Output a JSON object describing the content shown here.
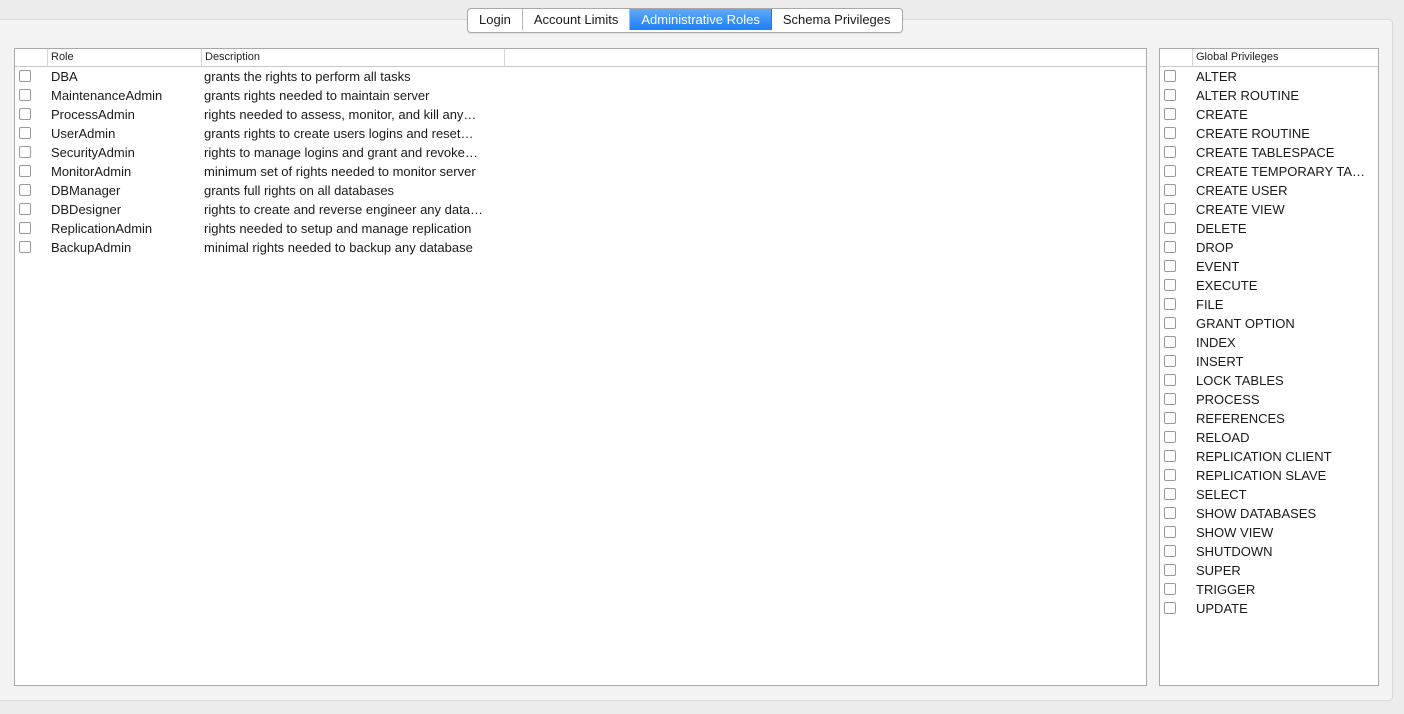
{
  "tabs": [
    {
      "label": "Login",
      "active": false
    },
    {
      "label": "Account Limits",
      "active": false
    },
    {
      "label": "Administrative Roles",
      "active": true
    },
    {
      "label": "Schema Privileges",
      "active": false
    }
  ],
  "roles_table": {
    "columns": {
      "role": "Role",
      "description": "Description"
    },
    "rows": [
      {
        "role": "DBA",
        "description": "grants the rights to perform all tasks",
        "checked": false
      },
      {
        "role": "MaintenanceAdmin",
        "description": "grants rights needed to maintain server",
        "checked": false
      },
      {
        "role": "ProcessAdmin",
        "description": "rights needed to assess, monitor, and kill any…",
        "checked": false
      },
      {
        "role": "UserAdmin",
        "description": "grants rights to create users logins and reset…",
        "checked": false
      },
      {
        "role": "SecurityAdmin",
        "description": "rights to manage logins and grant and revoke…",
        "checked": false
      },
      {
        "role": "MonitorAdmin",
        "description": "minimum set of rights needed to monitor server",
        "checked": false
      },
      {
        "role": "DBManager",
        "description": "grants full rights on all databases",
        "checked": false
      },
      {
        "role": "DBDesigner",
        "description": "rights to create and reverse engineer any data…",
        "checked": false
      },
      {
        "role": "ReplicationAdmin",
        "description": "rights needed to setup and manage replication",
        "checked": false
      },
      {
        "role": "BackupAdmin",
        "description": "minimal rights needed to backup any database",
        "checked": false
      }
    ]
  },
  "privileges_table": {
    "column": "Global Privileges",
    "rows": [
      {
        "name": "ALTER",
        "checked": false
      },
      {
        "name": "ALTER ROUTINE",
        "checked": false
      },
      {
        "name": "CREATE",
        "checked": false
      },
      {
        "name": "CREATE ROUTINE",
        "checked": false
      },
      {
        "name": "CREATE TABLESPACE",
        "checked": false
      },
      {
        "name": "CREATE TEMPORARY TA…",
        "checked": false
      },
      {
        "name": "CREATE USER",
        "checked": false
      },
      {
        "name": "CREATE VIEW",
        "checked": false
      },
      {
        "name": "DELETE",
        "checked": false
      },
      {
        "name": "DROP",
        "checked": false
      },
      {
        "name": "EVENT",
        "checked": false
      },
      {
        "name": "EXECUTE",
        "checked": false
      },
      {
        "name": "FILE",
        "checked": false
      },
      {
        "name": "GRANT OPTION",
        "checked": false
      },
      {
        "name": "INDEX",
        "checked": false
      },
      {
        "name": "INSERT",
        "checked": false
      },
      {
        "name": "LOCK TABLES",
        "checked": false
      },
      {
        "name": "PROCESS",
        "checked": false
      },
      {
        "name": "REFERENCES",
        "checked": false
      },
      {
        "name": "RELOAD",
        "checked": false
      },
      {
        "name": "REPLICATION CLIENT",
        "checked": false
      },
      {
        "name": "REPLICATION SLAVE",
        "checked": false
      },
      {
        "name": "SELECT",
        "checked": false
      },
      {
        "name": "SHOW DATABASES",
        "checked": false
      },
      {
        "name": "SHOW VIEW",
        "checked": false
      },
      {
        "name": "SHUTDOWN",
        "checked": false
      },
      {
        "name": "SUPER",
        "checked": false
      },
      {
        "name": "TRIGGER",
        "checked": false
      },
      {
        "name": "UPDATE",
        "checked": false
      }
    ]
  },
  "colors": {
    "accent": "#1d7ef6",
    "accent_light": "#5fa9fb"
  }
}
